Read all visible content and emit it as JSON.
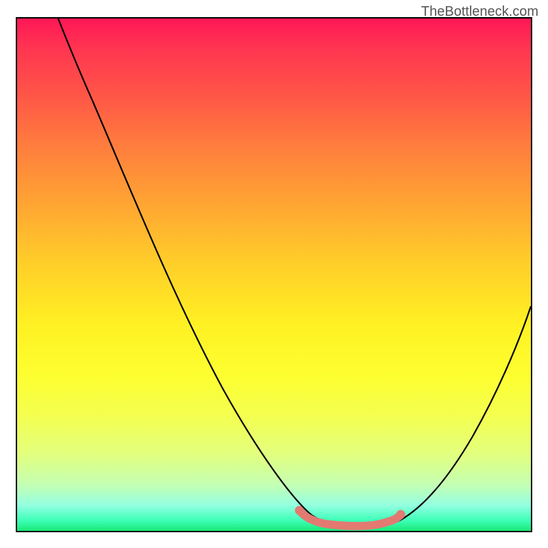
{
  "watermark": "TheBottleneck.com",
  "chart_data": {
    "type": "line",
    "title": "",
    "xlabel": "",
    "ylabel": "",
    "xlim": [
      0,
      100
    ],
    "ylim": [
      0,
      100
    ],
    "grid": false,
    "background": {
      "type": "vertical-gradient",
      "stops": [
        {
          "pos": 0.0,
          "color": "#ff1756"
        },
        {
          "pos": 0.5,
          "color": "#ffd628"
        },
        {
          "pos": 0.85,
          "color": "#e2ff7e"
        },
        {
          "pos": 1.0,
          "color": "#19e876"
        }
      ],
      "meaning": "heatmap from red (high bottleneck) at top to green (low bottleneck) at bottom"
    },
    "series": [
      {
        "name": "bottleneck-curve",
        "color": "#000000",
        "x": [
          0,
          6,
          12,
          18,
          24,
          30,
          36,
          42,
          48,
          54,
          58,
          62,
          66,
          70,
          74,
          78,
          82,
          86,
          90,
          94,
          100
        ],
        "y": [
          120,
          106,
          92,
          77,
          63,
          49,
          36,
          24,
          14,
          7,
          3.5,
          2,
          1.8,
          2,
          3,
          6,
          11,
          18,
          26,
          35,
          53
        ]
      },
      {
        "name": "optimal-range-highlight",
        "color": "#e27a72",
        "x": [
          54,
          58,
          62,
          66,
          70,
          72
        ],
        "y": [
          4,
          2.5,
          2,
          2,
          2.2,
          3
        ]
      }
    ],
    "annotations": []
  }
}
